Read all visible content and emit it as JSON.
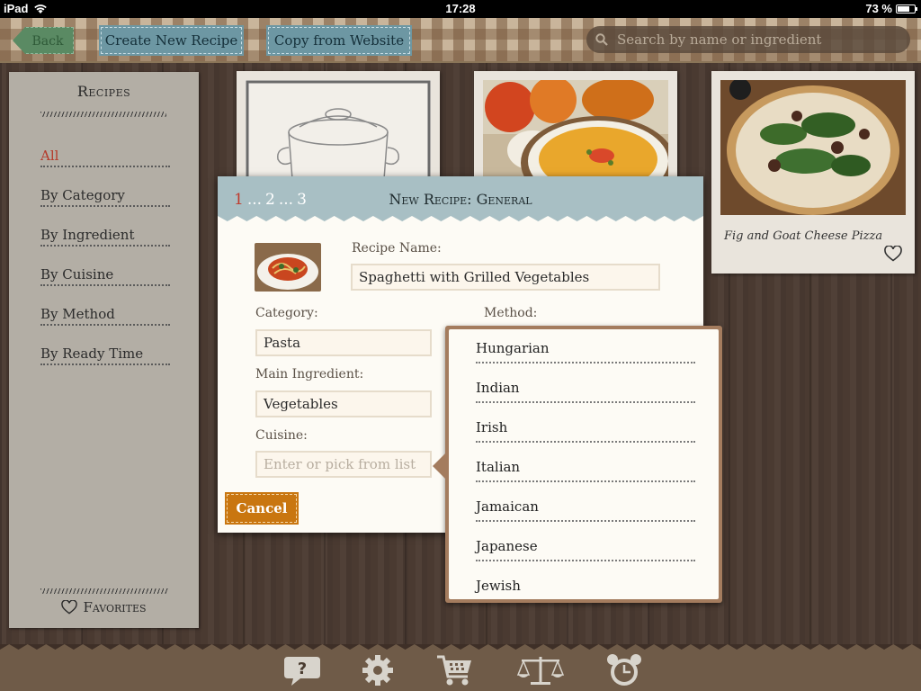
{
  "status_bar": {
    "device": "iPad",
    "time": "17:28",
    "battery": "73 %",
    "battery_level": 0.73
  },
  "toolbar": {
    "back_label": "Back",
    "create_label": "Create New Recipe",
    "copy_label": "Copy from Website",
    "search_placeholder": "Search by name or ingredient"
  },
  "sidebar": {
    "heading": "Recipes",
    "items": [
      {
        "label": "All",
        "active": true
      },
      {
        "label": "By Category",
        "active": false
      },
      {
        "label": "By Ingredient",
        "active": false
      },
      {
        "label": "By Cuisine",
        "active": false
      },
      {
        "label": "By Method",
        "active": false
      },
      {
        "label": "By Ready Time",
        "active": false
      }
    ],
    "favorites_label": "Favorites"
  },
  "cards": [
    {
      "title": "",
      "image": "pot-drawing"
    },
    {
      "title": "",
      "image": "pumpkin-soup-photo"
    },
    {
      "title": "Fig and Goat Cheese Pizza",
      "image": "pizza-photo"
    }
  ],
  "modal": {
    "steps": [
      "1",
      "...",
      "2",
      "...",
      "3"
    ],
    "current_step": "1",
    "title": "New Recipe: General",
    "recipe_name_label": "Recipe Name:",
    "recipe_name_value": "Spaghetti with Grilled Vegetables",
    "category_label": "Category:",
    "category_value": "Pasta",
    "method_label": "Method:",
    "main_ingredient_label": "Main Ingredient:",
    "main_ingredient_value": "Vegetables",
    "cuisine_label": "Cuisine:",
    "cuisine_placeholder": "Enter or pick from list",
    "cancel_label": "Cancel"
  },
  "cuisine_list": [
    "Hungarian",
    "Indian",
    "Irish",
    "Italian",
    "Jamaican",
    "Japanese",
    "Jewish"
  ],
  "bottom_bar": {
    "icons": [
      "help-icon",
      "settings-gear-icon",
      "shopping-cart-icon",
      "scale-icon",
      "timer-clock-icon"
    ]
  },
  "colors": {
    "accent_red": "#b53a2a",
    "toolbar_button": "#6d97a3",
    "cancel_button": "#c97610",
    "modal_header": "#a8bfc4",
    "popover_border": "#a47c5e"
  }
}
